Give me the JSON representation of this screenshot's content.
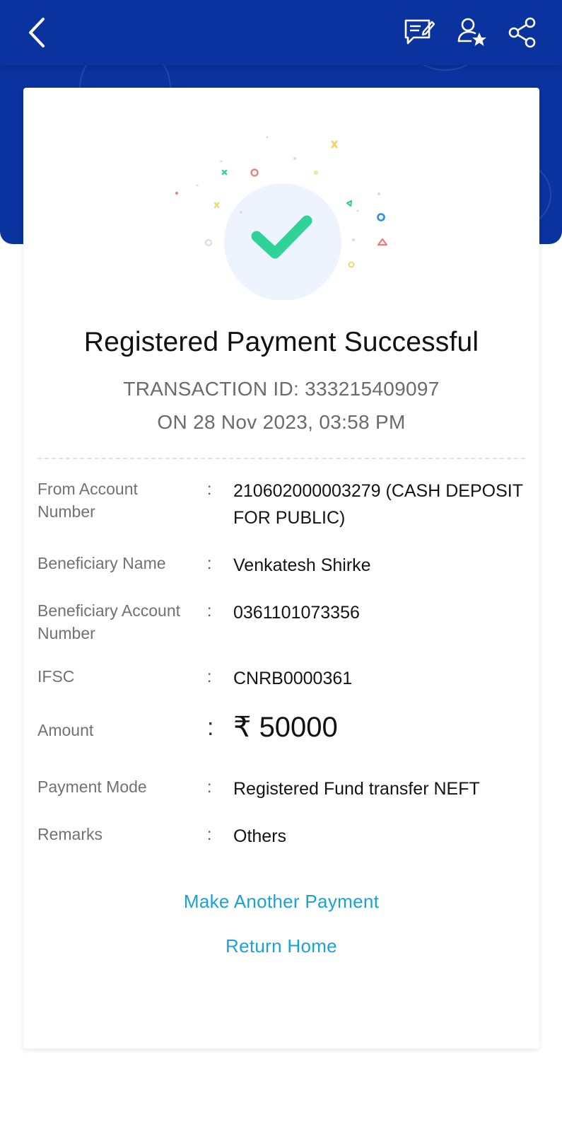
{
  "header": {
    "back_icon": "chevron-left-icon",
    "icons": [
      "feedback-edit-icon",
      "favourite-beneficiary-icon",
      "share-icon"
    ]
  },
  "status": {
    "icon": "checkmark-icon",
    "title": "Registered Payment Successful",
    "transaction_line": "TRANSACTION ID: 333215409097",
    "date_line": "ON 28 Nov 2023, 03:58 PM"
  },
  "details": [
    {
      "label": "From Account Number",
      "value": "210602000003279 (CASH DEPOSIT FOR PUBLIC)"
    },
    {
      "label": "Beneficiary Name",
      "value": "Venkatesh Shirke"
    },
    {
      "label": "Beneficiary Account Number",
      "value": "0361101073356"
    },
    {
      "label": "IFSC",
      "value": "CNRB0000361"
    },
    {
      "label": "Amount",
      "value": "₹ 50000"
    },
    {
      "label": "Payment Mode",
      "value": "Registered Fund transfer NEFT"
    },
    {
      "label": "Remarks",
      "value": "Others"
    }
  ],
  "separator": ":",
  "actions": {
    "make_another": "Make Another Payment",
    "return_home": "Return Home"
  },
  "colors": {
    "brand_blue": "#0a33a0",
    "success_green": "#2fd39a",
    "link_blue": "#1aa2d8"
  }
}
